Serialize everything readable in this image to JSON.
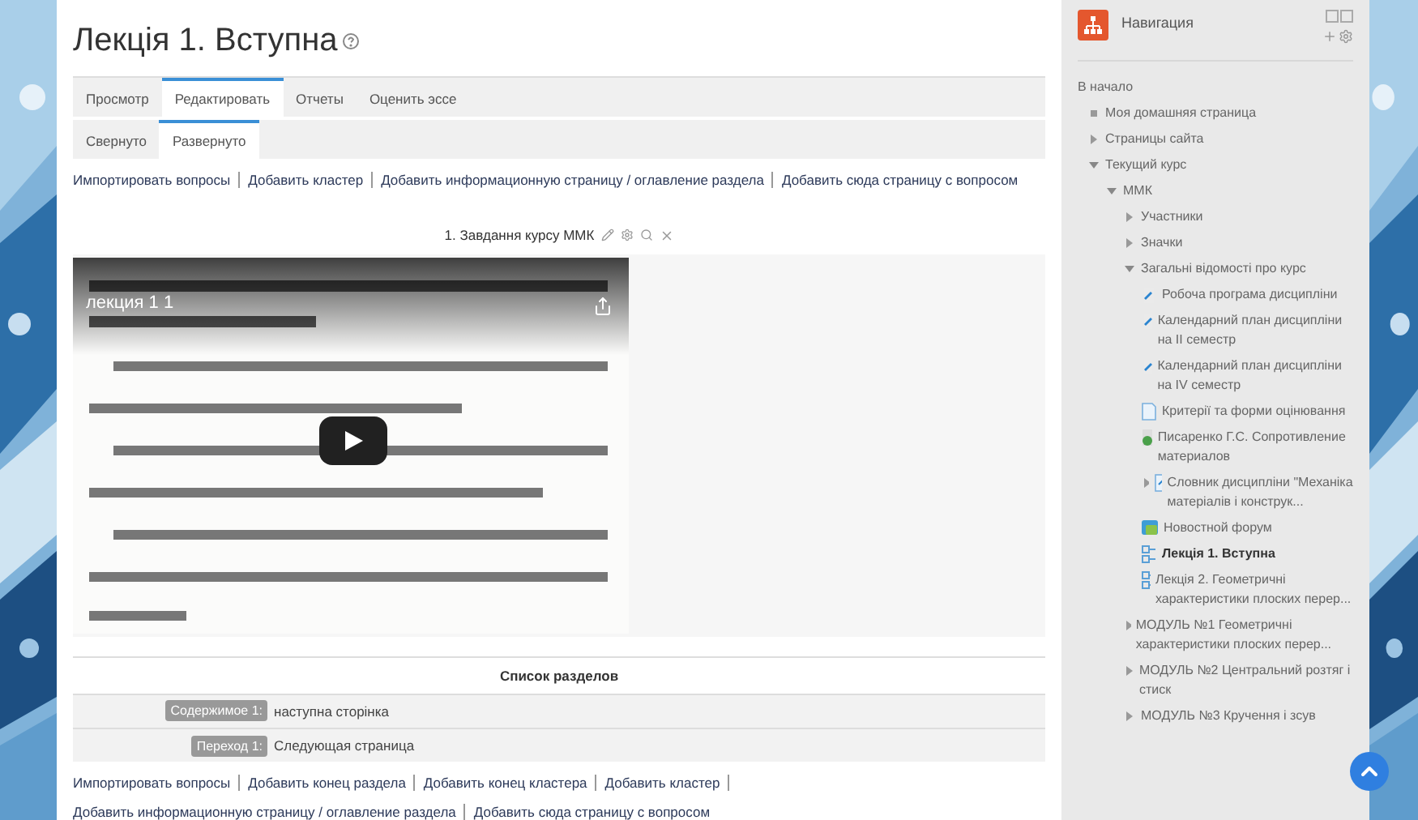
{
  "page": {
    "title": "Лекція 1. Вступна"
  },
  "tabs": [
    {
      "label": "Просмотр",
      "selected": false
    },
    {
      "label": "Редактировать",
      "selected": true
    },
    {
      "label": "Отчеты",
      "selected": false
    },
    {
      "label": "Оценить эссе",
      "selected": false
    }
  ],
  "subtabs": [
    {
      "label": "Свернуто",
      "selected": false
    },
    {
      "label": "Развернуто",
      "selected": true
    }
  ],
  "actions_top": [
    "Импортировать вопросы",
    "Добавить кластер",
    "Добавить информационную страницу / оглавление раздела",
    "Добавить сюда страницу с вопросом"
  ],
  "page_block": {
    "title": "1. Завдання курсу ММК",
    "video": {
      "title": "лекция 1 1",
      "kind": "picture"
    }
  },
  "sections_list": {
    "title": "Список разделов",
    "rows": [
      {
        "badge": "Содержимое 1:",
        "text": "наступна сторінка"
      },
      {
        "badge": "Переход 1:",
        "text": "Следующая страница"
      }
    ]
  },
  "actions_bottom": [
    "Импортировать вопросы",
    "Добавить конец раздела",
    "Добавить конец кластера",
    "Добавить кластер",
    "Добавить информационную страницу / оглавление раздела",
    "Добавить сюда страницу с вопросом"
  ],
  "navigation": {
    "title": "Навигация",
    "items": [
      {
        "label": "В начало",
        "selected": false,
        "children": [
          {
            "label": "Моя домашняя страница",
            "kind": "bullet",
            "selected": false
          },
          {
            "label": "Страницы сайта",
            "kind": "branch",
            "expanded": false,
            "selected": false
          },
          {
            "label": "Текущий курс",
            "kind": "branch",
            "expanded": true,
            "selected": false,
            "children": [
              {
                "label": "ММК",
                "kind": "branch",
                "expanded": true,
                "selected": false,
                "children": [
                  {
                    "label": "Участники",
                    "kind": "branch",
                    "expanded": false,
                    "selected": false
                  },
                  {
                    "label": "Значки",
                    "kind": "branch",
                    "expanded": false,
                    "selected": false
                  },
                  {
                    "label": "Загальні відомості про курс",
                    "kind": "branch",
                    "expanded": true,
                    "selected": false,
                    "children": [
                      {
                        "label": "Робоча програма дисципліни",
                        "kind": "file",
                        "selected": false
                      },
                      {
                        "label": "Календарний план дисципліни на ІІ семестр",
                        "kind": "file",
                        "selected": false
                      },
                      {
                        "label": "Календарний план дисципліни на IV семестр",
                        "kind": "file",
                        "selected": false
                      },
                      {
                        "label": "Критерії та форми оцінювання",
                        "kind": "page",
                        "selected": false
                      },
                      {
                        "label": "Писаренко Г.С. Сопротивление материалов",
                        "kind": "url",
                        "selected": false
                      },
                      {
                        "label": "Словник дисципліни \"Механіка матеріалів і конструк...",
                        "kind": "glossary",
                        "expanded": false,
                        "selected": false
                      },
                      {
                        "label": "Новостной форум",
                        "kind": "forum",
                        "selected": false
                      },
                      {
                        "label": "Лекція 1. Вступна",
                        "kind": "lesson",
                        "selected": true
                      },
                      {
                        "label": "Лекція 2. Геометричні характеристики плоских перер...",
                        "kind": "lesson",
                        "selected": false
                      }
                    ]
                  },
                  {
                    "label": "МОДУЛЬ №1 Геометричні характеристики плоских перер...",
                    "kind": "branch",
                    "expanded": false,
                    "selected": false
                  },
                  {
                    "label": "МОДУЛЬ №2 Центральний розтяг і стиск",
                    "kind": "branch",
                    "expanded": false,
                    "selected": false
                  },
                  {
                    "label": "МОДУЛЬ №3 Кручення і зсув",
                    "kind": "branch",
                    "expanded": false,
                    "selected": false
                  }
                ]
              }
            ]
          }
        ]
      }
    ]
  }
}
